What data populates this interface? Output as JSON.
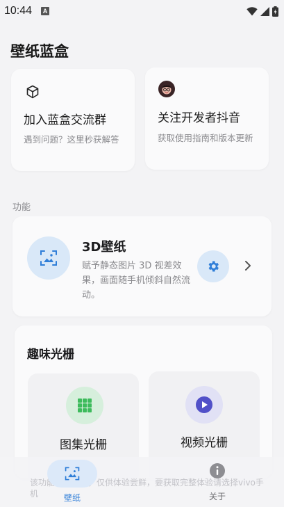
{
  "status_bar": {
    "time": "10:44",
    "notification_glyph": "A"
  },
  "app": {
    "title": "壁纸蓝盒"
  },
  "cards": {
    "join": {
      "title": "加入蓝盒交流群",
      "subtitle": "遇到问题？这里秒获解答",
      "icon": "cube-icon"
    },
    "follow": {
      "title": "关注开发者抖音",
      "subtitle": "获取使用指南和版本更新",
      "icon": "developer-avatar"
    }
  },
  "section": {
    "label": "功能"
  },
  "feature_3d": {
    "title": "3D壁纸",
    "description": "赋予静态图片 3D 视差效果，画面随手机倾斜自然流动。",
    "icons": [
      "image-icon",
      "gear-icon",
      "chevron-right-icon"
    ]
  },
  "grating": {
    "title": "趣味光栅",
    "items": [
      {
        "label": "图集光栅",
        "icon": "grid-icon",
        "color": "#3dbb5c"
      },
      {
        "label": "视频光栅",
        "icon": "play-icon",
        "color": "#5150c8"
      }
    ]
  },
  "bottom_nav": {
    "notice": "该功能暂不可用，仅供体验尝鲜，要获取完整体验请选择vivo手机",
    "items": [
      {
        "label": "壁纸",
        "icon": "wallpaper-icon",
        "active": true
      },
      {
        "label": "关于",
        "icon": "info-icon",
        "active": false
      }
    ]
  },
  "colors": {
    "accent": "#2f7ed8",
    "icon_blue_bg": "#d9e8f8",
    "background": "#f3f3f5"
  }
}
